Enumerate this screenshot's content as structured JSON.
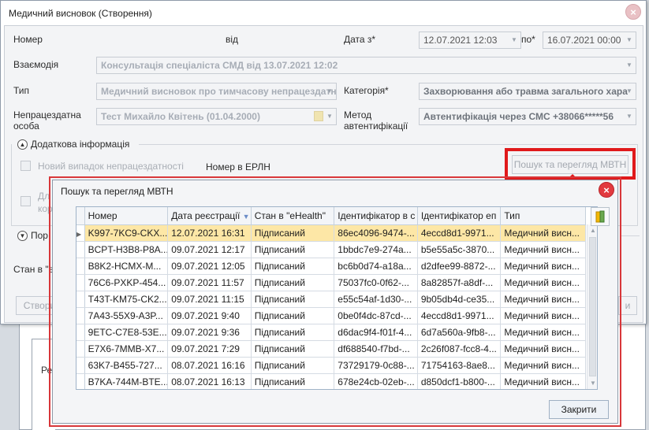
{
  "dialog": {
    "title": "Медичний висновок (Створення)",
    "close_symbol": "×",
    "fields": {
      "nomer_label": "Номер",
      "vid_label": "від",
      "data_z_label": "Дата з*",
      "data_z_value": "12.07.2021 12:03",
      "po_label": "по*",
      "po_value": "16.07.2021 00:00",
      "vzaemodiya_label": "Взаємодія",
      "vzaemodiya_value": "Консультація спеціаліста СМД від 13.07.2021 12:02",
      "typ_label": "Тип",
      "typ_value": "Медичний висновок про тимчасову непрацездатн",
      "kategoriya_label": "Категорія*",
      "kategoriya_value": "Захворювання або травма загального хара",
      "osoba_label_1": "Непрацездатна",
      "osoba_label_2": "особа",
      "osoba_value": "Тест Михайло Квітень (01.04.2000)",
      "metod_label_1": "Метод",
      "metod_label_2": "автентифікації",
      "metod_value": "Автентифікація через СМС +38066*****56"
    },
    "dodatkova": {
      "header": "Додаткова інформація",
      "new_case_label": "Новий випадок непрацездатності",
      "erln_label": "Номер в ЕРЛН",
      "search_button": "Пошук та перегляд МВТН",
      "truncated_1": "Дл",
      "truncated_2": "кор"
    },
    "partial": {
      "section2": "Пор",
      "stan_label": "Стан в \"e",
      "create_button": "Створи",
      "right_button": "и"
    }
  },
  "background": {
    "label_re": "Ре"
  },
  "popup": {
    "title": "Пошук та перегляд МВТН",
    "close_symbol": "×",
    "close_button": "Закрити",
    "columns": [
      "Номер",
      "Дата реєстрації",
      "Стан в \"eHealth\"",
      "Ідентифікатор в с",
      "Ідентифікатор еп",
      "Тип"
    ],
    "rows": [
      [
        "K997-7KC9-CKX...",
        "12.07.2021 16:31",
        "Підписаний",
        "86ec4096-9474-...",
        "4eccd8d1-9971...",
        "Медичний висн..."
      ],
      [
        "BCPT-H3B8-P8A...",
        "09.07.2021 12:17",
        "Підписаний",
        "1bbdc7e9-274a...",
        "b5e55a5c-3870...",
        "Медичний висн..."
      ],
      [
        "B8K2-HCMX-M...",
        "09.07.2021 12:05",
        "Підписаний",
        "bc6b0d74-a18a...",
        "d2dfee99-8872-...",
        "Медичний висн..."
      ],
      [
        "76C6-PXKP-454...",
        "09.07.2021 11:57",
        "Підписаний",
        "75037fc0-0f62-...",
        "8a82857f-a8df-...",
        "Медичний висн..."
      ],
      [
        "T43T-KM75-CK2...",
        "09.07.2021 11:15",
        "Підписаний",
        "e55c54af-1d30-...",
        "9b05db4d-ce35...",
        "Медичний висн..."
      ],
      [
        "7A43-55X9-A3P...",
        "09.07.2021 9:40",
        "Підписаний",
        "0be0f4dc-87cd-...",
        "4eccd8d1-9971...",
        "Медичний висн..."
      ],
      [
        "9ETC-C7E8-53E...",
        "09.07.2021 9:36",
        "Підписаний",
        "d6dac9f4-f01f-4...",
        "6d7a560a-9fb8-...",
        "Медичний висн..."
      ],
      [
        "E7X6-7MMB-X7...",
        "09.07.2021 7:29",
        "Підписаний",
        "df688540-f7bd-...",
        "2c26f087-fcc8-4...",
        "Медичний висн..."
      ],
      [
        "63K7-B455-727...",
        "08.07.2021 16:16",
        "Підписаний",
        "73729179-0c88-...",
        "71754163-8ae8...",
        "Медичний висн..."
      ],
      [
        "B7KA-744M-BTE...",
        "08.07.2021 16:13",
        "Підписаний",
        "678e24cb-02eb-...",
        "d850dcf1-b800-...",
        "Медичний висн..."
      ]
    ],
    "selected_row": 0
  },
  "colors": {
    "annotation_red": "#e0191b",
    "selected_row": "#fde7a6",
    "popup_close": "#e23a3f"
  }
}
